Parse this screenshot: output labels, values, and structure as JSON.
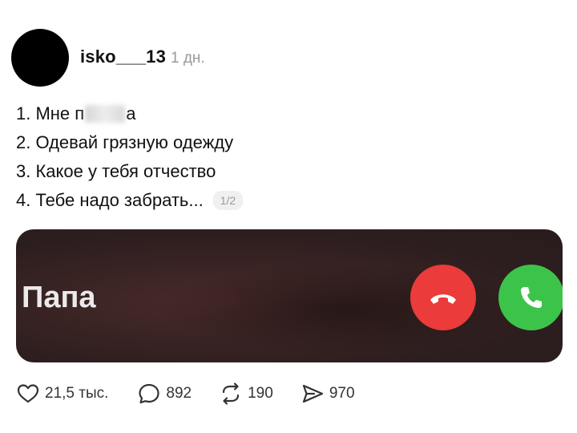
{
  "post": {
    "username": "isko___13",
    "time": "1 дн.",
    "lines": [
      {
        "pre": "1. Мне п",
        "post": "а"
      },
      {
        "text": "2. Одевай грязную одежду"
      },
      {
        "text": "3. Какое у тебя отчество"
      },
      {
        "text": "4. Тебе надо забрать..."
      }
    ],
    "page_indicator": "1/2"
  },
  "media": {
    "caller_name": "Папа",
    "decline_color": "#eb3b3b",
    "accept_color": "#3cc44a"
  },
  "actions": {
    "likes": "21,5 тыс.",
    "comments": "892",
    "reposts": "190",
    "shares": "970"
  }
}
